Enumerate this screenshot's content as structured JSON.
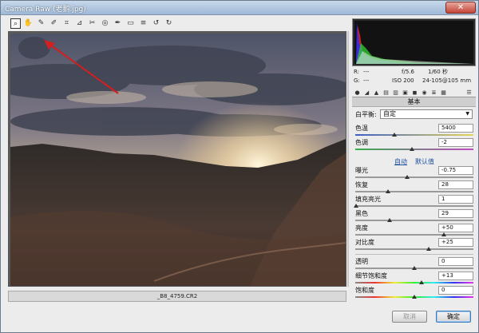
{
  "window": {
    "title": "Camera Raw (老鹅.jpg)",
    "close_label": "✕"
  },
  "toolbar": {
    "tools": [
      "zoom-tool",
      "hand-tool",
      "white-balance-tool",
      "color-sampler-tool",
      "crop-tool",
      "straighten-tool",
      "spot-removal-tool",
      "red-eye-tool",
      "adjustment-brush-tool",
      "graduated-filter-tool",
      "preferences-tool",
      "rotate-left-tool",
      "rotate-right-tool"
    ]
  },
  "image": {
    "filename": "_B8_4759.CR2"
  },
  "camera_info": {
    "r_label": "R:",
    "r_val": "---",
    "g_label": "G:",
    "g_val": "---",
    "aperture": "f/5.6",
    "shutter": "1/60 秒",
    "iso": "ISO 200",
    "lens": "24-105@105 mm"
  },
  "panel": {
    "title": "基本",
    "white_balance": {
      "label": "白平衡:",
      "value": "自定"
    },
    "temperature": {
      "label": "色温",
      "value": "5400",
      "level": 0.33
    },
    "tint": {
      "label": "色调",
      "value": "-2",
      "level": 0.48
    },
    "auto_link": "自动",
    "default_link": "默认值",
    "exposure": {
      "label": "曝光",
      "value": "-0.75",
      "level": 0.44
    },
    "recovery": {
      "label": "恢复",
      "value": "28",
      "level": 0.28
    },
    "fill_light": {
      "label": "填充亮光",
      "value": "1",
      "level": 0.01
    },
    "blacks": {
      "label": "黑色",
      "value": "29",
      "level": 0.29
    },
    "brightness": {
      "label": "亮度",
      "value": "+50",
      "level": 0.75
    },
    "contrast": {
      "label": "对比度",
      "value": "+25",
      "level": 0.62
    },
    "clarity": {
      "label": "透明",
      "value": "0",
      "level": 0.5
    },
    "vibrance": {
      "label": "细节饱和度",
      "value": "+13",
      "level": 0.56
    },
    "saturation": {
      "label": "饱和度",
      "value": "0",
      "level": 0.5
    }
  },
  "buttons": {
    "cancel": "取消",
    "ok": "确定"
  },
  "colors": {
    "accent": "#3b7bbf",
    "arrow": "#d21f1f"
  }
}
